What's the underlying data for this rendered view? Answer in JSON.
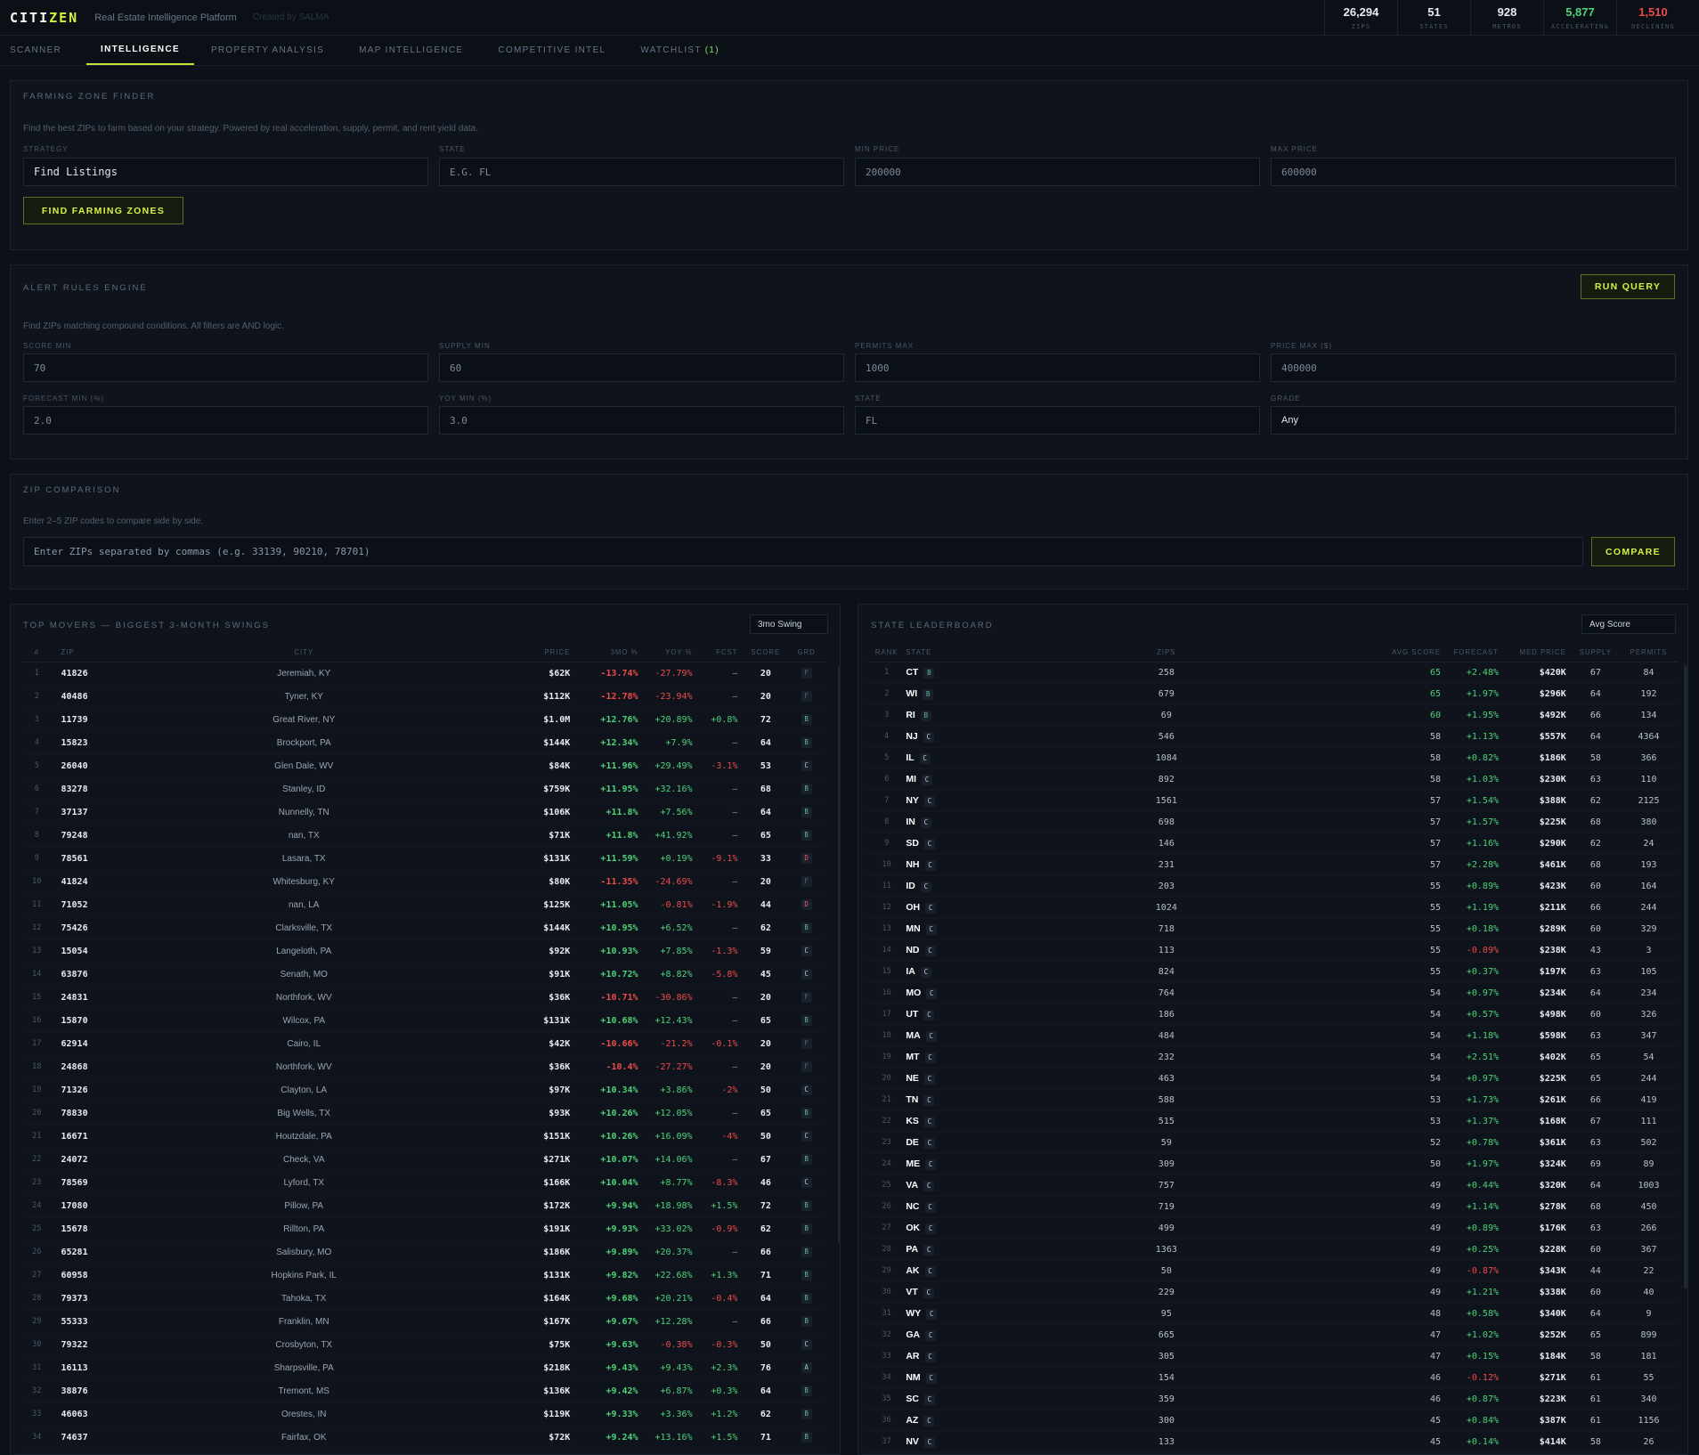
{
  "app": {
    "logo_a": "CITI",
    "logo_b": "ZEN",
    "tagline": "Real Estate Intelligence Platform",
    "tagline2": "Created by SALMA"
  },
  "stats": [
    {
      "value": "26,294",
      "label": "ZIPS",
      "color": "#e8edf3"
    },
    {
      "value": "51",
      "label": "STATES",
      "color": "#e8edf3"
    },
    {
      "value": "928",
      "label": "METROS",
      "color": "#e8edf3"
    },
    {
      "value": "5,877",
      "label": "ACCELERATING",
      "color": "#4fd27a"
    },
    {
      "value": "1,510",
      "label": "DECLINING",
      "color": "#ef4a4a"
    }
  ],
  "tabs": [
    {
      "label": "SCANNER",
      "active": false
    },
    {
      "label": "INTELLIGENCE",
      "active": true
    },
    {
      "label": "PROPERTY ANALYSIS",
      "active": false
    },
    {
      "label": "MAP INTELLIGENCE",
      "active": false
    },
    {
      "label": "COMPETITIVE INTEL",
      "active": false
    },
    {
      "label": "WATCHLIST",
      "active": false,
      "badge": "(1)"
    }
  ],
  "farming": {
    "title": "FARMING ZONE FINDER",
    "desc": "Find the best ZIPs to farm based on your strategy. Powered by real acceleration, supply, permit, and rent yield data.",
    "fields": [
      {
        "label": "STRATEGY",
        "value": "Find Listings",
        "bright": true
      },
      {
        "label": "STATE",
        "value": "E.G. FL"
      },
      {
        "label": "MIN PRICE",
        "value": "200000"
      },
      {
        "label": "MAX PRICE",
        "value": "600000"
      }
    ],
    "button": "FIND FARMING ZONES"
  },
  "alerts": {
    "title": "ALERT RULES ENGINE",
    "button": "RUN QUERY",
    "desc": "Find ZIPs matching compound conditions. All filters are AND logic.",
    "row1": [
      {
        "label": "SCORE MIN",
        "value": "70"
      },
      {
        "label": "SUPPLY MIN",
        "value": "60"
      },
      {
        "label": "PERMITS MAX",
        "value": "1000"
      },
      {
        "label": "PRICE MAX ($)",
        "value": "400000"
      }
    ],
    "row2": [
      {
        "label": "FORECAST MIN (%)",
        "value": "2.0"
      },
      {
        "label": "YOY MIN (%)",
        "value": "3.0"
      },
      {
        "label": "STATE",
        "value": "FL"
      },
      {
        "label": "GRADE",
        "value": "Any",
        "select": true
      }
    ]
  },
  "compare": {
    "title": "ZIP COMPARISON",
    "desc": "Enter 2–5 ZIP codes to compare side by side.",
    "placeholder": "Enter ZIPs separated by commas (e.g. 33139, 90210, 78701)",
    "button": "COMPARE"
  },
  "movers": {
    "title": "TOP MOVERS — BIGGEST 3-MONTH SWINGS",
    "sort": "3mo Swing",
    "headers": [
      "#",
      "ZIP",
      "CITY",
      "PRICE",
      "3MO %",
      "YOY %",
      "FCST",
      "SCORE",
      "GRD"
    ],
    "rows": [
      [
        "1",
        "41826",
        "Jeremiah, KY",
        "$62K",
        "-13.74%",
        "-27.79%",
        "—",
        "20",
        "F"
      ],
      [
        "2",
        "40486",
        "Tyner, KY",
        "$112K",
        "-12.78%",
        "-23.94%",
        "—",
        "20",
        "F"
      ],
      [
        "3",
        "11739",
        "Great River, NY",
        "$1.0M",
        "+12.76%",
        "+20.89%",
        "+0.8%",
        "72",
        "B"
      ],
      [
        "4",
        "15823",
        "Brockport, PA",
        "$144K",
        "+12.34%",
        "+7.9%",
        "—",
        "64",
        "B"
      ],
      [
        "5",
        "26040",
        "Glen Dale, WV",
        "$84K",
        "+11.96%",
        "+29.49%",
        "-3.1%",
        "53",
        "C"
      ],
      [
        "6",
        "83278",
        "Stanley, ID",
        "$759K",
        "+11.95%",
        "+32.16%",
        "—",
        "68",
        "B"
      ],
      [
        "7",
        "37137",
        "Nunnelly, TN",
        "$106K",
        "+11.8%",
        "+7.56%",
        "—",
        "64",
        "B"
      ],
      [
        "8",
        "79248",
        "nan, TX",
        "$71K",
        "+11.8%",
        "+41.92%",
        "—",
        "65",
        "B"
      ],
      [
        "9",
        "78561",
        "Lasara, TX",
        "$131K",
        "+11.59%",
        "+0.19%",
        "-9.1%",
        "33",
        "D"
      ],
      [
        "10",
        "41824",
        "Whitesburg, KY",
        "$80K",
        "-11.35%",
        "-24.69%",
        "—",
        "20",
        "F"
      ],
      [
        "11",
        "71052",
        "nan, LA",
        "$125K",
        "+11.05%",
        "-0.81%",
        "-1.9%",
        "44",
        "D"
      ],
      [
        "12",
        "75426",
        "Clarksville, TX",
        "$144K",
        "+10.95%",
        "+6.52%",
        "—",
        "62",
        "B"
      ],
      [
        "13",
        "15054",
        "Langeloth, PA",
        "$92K",
        "+10.93%",
        "+7.85%",
        "-1.3%",
        "59",
        "C"
      ],
      [
        "14",
        "63876",
        "Senath, MO",
        "$91K",
        "+10.72%",
        "+8.82%",
        "-5.8%",
        "45",
        "C"
      ],
      [
        "15",
        "24831",
        "Northfork, WV",
        "$36K",
        "-10.71%",
        "-30.86%",
        "—",
        "20",
        "F"
      ],
      [
        "16",
        "15870",
        "Wilcox, PA",
        "$131K",
        "+10.68%",
        "+12.43%",
        "—",
        "65",
        "B"
      ],
      [
        "17",
        "62914",
        "Cairo, IL",
        "$42K",
        "-10.66%",
        "-21.2%",
        "-0.1%",
        "20",
        "F"
      ],
      [
        "18",
        "24868",
        "Northfork, WV",
        "$36K",
        "-10.4%",
        "-27.27%",
        "—",
        "20",
        "F"
      ],
      [
        "19",
        "71326",
        "Clayton, LA",
        "$97K",
        "+10.34%",
        "+3.86%",
        "-2%",
        "50",
        "C"
      ],
      [
        "20",
        "78830",
        "Big Wells, TX",
        "$93K",
        "+10.26%",
        "+12.05%",
        "—",
        "65",
        "B"
      ],
      [
        "21",
        "16671",
        "Houtzdale, PA",
        "$151K",
        "+10.26%",
        "+16.09%",
        "-4%",
        "50",
        "C"
      ],
      [
        "22",
        "24072",
        "Check, VA",
        "$271K",
        "+10.07%",
        "+14.06%",
        "—",
        "67",
        "B"
      ],
      [
        "23",
        "78569",
        "Lyford, TX",
        "$166K",
        "+10.04%",
        "+8.77%",
        "-8.3%",
        "46",
        "C"
      ],
      [
        "24",
        "17080",
        "Pillow, PA",
        "$172K",
        "+9.94%",
        "+18.98%",
        "+1.5%",
        "72",
        "B"
      ],
      [
        "25",
        "15678",
        "Rillton, PA",
        "$191K",
        "+9.93%",
        "+33.02%",
        "-0.9%",
        "62",
        "B"
      ],
      [
        "26",
        "65281",
        "Salisbury, MO",
        "$186K",
        "+9.89%",
        "+20.37%",
        "—",
        "66",
        "B"
      ],
      [
        "27",
        "60958",
        "Hopkins Park, IL",
        "$131K",
        "+9.82%",
        "+22.68%",
        "+1.3%",
        "71",
        "B"
      ],
      [
        "28",
        "79373",
        "Tahoka, TX",
        "$164K",
        "+9.68%",
        "+20.21%",
        "-0.4%",
        "64",
        "B"
      ],
      [
        "29",
        "55333",
        "Franklin, MN",
        "$167K",
        "+9.67%",
        "+12.28%",
        "—",
        "66",
        "B"
      ],
      [
        "30",
        "79322",
        "Crosbyton, TX",
        "$75K",
        "+9.63%",
        "-0.38%",
        "-0.3%",
        "50",
        "C"
      ],
      [
        "31",
        "16113",
        "Sharpsville, PA",
        "$218K",
        "+9.43%",
        "+9.43%",
        "+2.3%",
        "76",
        "A"
      ],
      [
        "32",
        "38876",
        "Tremont, MS",
        "$136K",
        "+9.42%",
        "+6.87%",
        "+0.3%",
        "64",
        "B"
      ],
      [
        "33",
        "46063",
        "Orestes, IN",
        "$119K",
        "+9.33%",
        "+3.36%",
        "+1.2%",
        "62",
        "B"
      ],
      [
        "34",
        "74637",
        "Fairfax, OK",
        "$72K",
        "+9.24%",
        "+13.16%",
        "+1.5%",
        "71",
        "B"
      ]
    ]
  },
  "leaders": {
    "title": "STATE LEADERBOARD",
    "sort": "Avg Score",
    "headers": [
      "RANK",
      "STATE",
      "ZIPS",
      "AVG SCORE",
      "FORECAST",
      "MED PRICE",
      "SUPPLY",
      "PERMITS"
    ],
    "rows": [
      [
        "1",
        "CT",
        "B",
        "258",
        "65",
        "+2.48%",
        "$420K",
        "67",
        "84"
      ],
      [
        "2",
        "WI",
        "B",
        "679",
        "65",
        "+1.97%",
        "$296K",
        "64",
        "192"
      ],
      [
        "3",
        "RI",
        "B",
        "69",
        "60",
        "+1.95%",
        "$492K",
        "66",
        "134"
      ],
      [
        "4",
        "NJ",
        "C",
        "546",
        "58",
        "+1.13%",
        "$557K",
        "64",
        "4364"
      ],
      [
        "5",
        "IL",
        "C",
        "1084",
        "58",
        "+0.82%",
        "$186K",
        "58",
        "366"
      ],
      [
        "6",
        "MI",
        "C",
        "892",
        "58",
        "+1.03%",
        "$230K",
        "63",
        "110"
      ],
      [
        "7",
        "NY",
        "C",
        "1561",
        "57",
        "+1.54%",
        "$388K",
        "62",
        "2125"
      ],
      [
        "8",
        "IN",
        "C",
        "698",
        "57",
        "+1.57%",
        "$225K",
        "68",
        "380"
      ],
      [
        "9",
        "SD",
        "C",
        "146",
        "57",
        "+1.16%",
        "$290K",
        "62",
        "24"
      ],
      [
        "10",
        "NH",
        "C",
        "231",
        "57",
        "+2.28%",
        "$461K",
        "68",
        "193"
      ],
      [
        "11",
        "ID",
        "C",
        "203",
        "55",
        "+0.89%",
        "$423K",
        "60",
        "164"
      ],
      [
        "12",
        "OH",
        "C",
        "1024",
        "55",
        "+1.19%",
        "$211K",
        "66",
        "244"
      ],
      [
        "13",
        "MN",
        "C",
        "718",
        "55",
        "+0.18%",
        "$289K",
        "60",
        "329"
      ],
      [
        "14",
        "ND",
        "C",
        "113",
        "55",
        "-0.09%",
        "$238K",
        "43",
        "3"
      ],
      [
        "15",
        "IA",
        "C",
        "824",
        "55",
        "+0.37%",
        "$197K",
        "63",
        "105"
      ],
      [
        "16",
        "MO",
        "C",
        "764",
        "54",
        "+0.97%",
        "$234K",
        "64",
        "234"
      ],
      [
        "17",
        "UT",
        "C",
        "186",
        "54",
        "+0.57%",
        "$498K",
        "60",
        "326"
      ],
      [
        "18",
        "MA",
        "C",
        "484",
        "54",
        "+1.18%",
        "$598K",
        "63",
        "347"
      ],
      [
        "19",
        "MT",
        "C",
        "232",
        "54",
        "+2.51%",
        "$402K",
        "65",
        "54"
      ],
      [
        "20",
        "NE",
        "C",
        "463",
        "54",
        "+0.97%",
        "$225K",
        "65",
        "244"
      ],
      [
        "21",
        "TN",
        "C",
        "588",
        "53",
        "+1.73%",
        "$261K",
        "66",
        "419"
      ],
      [
        "22",
        "KS",
        "C",
        "515",
        "53",
        "+1.37%",
        "$168K",
        "67",
        "111"
      ],
      [
        "23",
        "DE",
        "C",
        "59",
        "52",
        "+0.78%",
        "$361K",
        "63",
        "502"
      ],
      [
        "24",
        "ME",
        "C",
        "309",
        "50",
        "+1.97%",
        "$324K",
        "69",
        "89"
      ],
      [
        "25",
        "VA",
        "C",
        "757",
        "49",
        "+0.44%",
        "$320K",
        "64",
        "1003"
      ],
      [
        "26",
        "NC",
        "C",
        "719",
        "49",
        "+1.14%",
        "$278K",
        "68",
        "450"
      ],
      [
        "27",
        "OK",
        "C",
        "499",
        "49",
        "+0.89%",
        "$176K",
        "63",
        "266"
      ],
      [
        "28",
        "PA",
        "C",
        "1363",
        "49",
        "+0.25%",
        "$228K",
        "60",
        "367"
      ],
      [
        "29",
        "AK",
        "C",
        "50",
        "49",
        "-0.87%",
        "$343K",
        "44",
        "22"
      ],
      [
        "30",
        "VT",
        "C",
        "229",
        "49",
        "+1.21%",
        "$338K",
        "60",
        "40"
      ],
      [
        "31",
        "WY",
        "C",
        "95",
        "48",
        "+0.58%",
        "$340K",
        "64",
        "9"
      ],
      [
        "32",
        "GA",
        "C",
        "665",
        "47",
        "+1.02%",
        "$252K",
        "65",
        "899"
      ],
      [
        "33",
        "AR",
        "C",
        "305",
        "47",
        "+0.15%",
        "$184K",
        "58",
        "181"
      ],
      [
        "34",
        "NM",
        "C",
        "154",
        "46",
        "-0.12%",
        "$271K",
        "61",
        "55"
      ],
      [
        "35",
        "SC",
        "C",
        "359",
        "46",
        "+0.87%",
        "$223K",
        "61",
        "340"
      ],
      [
        "36",
        "AZ",
        "C",
        "300",
        "45",
        "+0.84%",
        "$387K",
        "61",
        "1156"
      ],
      [
        "37",
        "NV",
        "C",
        "133",
        "45",
        "+0.14%",
        "$414K",
        "58",
        "26"
      ]
    ]
  }
}
